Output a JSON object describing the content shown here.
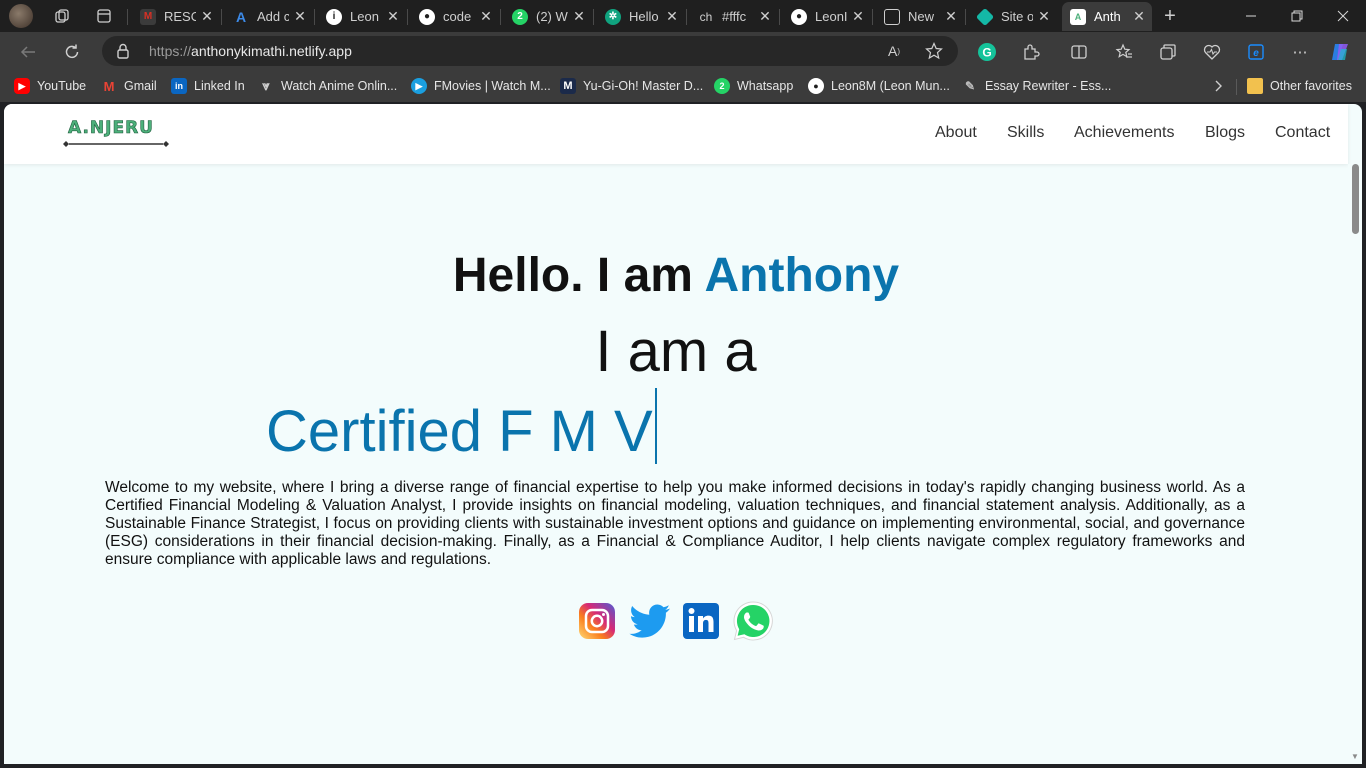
{
  "browser": {
    "tabs": [
      {
        "title": "RESO",
        "favicon": "gmail-icon",
        "color": "#d93025"
      },
      {
        "title": "Add c",
        "favicon": "azure-icon",
        "color": "#1f6fd0"
      },
      {
        "title": "Leon",
        "favicon": "info-icon",
        "color": "#ffffff"
      },
      {
        "title": "code",
        "favicon": "github-icon",
        "color": "#ffffff"
      },
      {
        "title": "(2) W",
        "favicon": "whatsapp-icon",
        "color": "#25d366"
      },
      {
        "title": "Hello",
        "favicon": "chatgpt-icon",
        "color": "#10a37f"
      },
      {
        "title": "#fffc",
        "favicon": "ch-text-icon",
        "color": "#1f1f1f"
      },
      {
        "title": "LeonI",
        "favicon": "github-icon",
        "color": "#ffffff"
      },
      {
        "title": "New",
        "favicon": "newtab-icon",
        "color": "#cfcfcf"
      },
      {
        "title": "Site o",
        "favicon": "netlify-icon",
        "color": "#14b8a6"
      },
      {
        "title": "Anth",
        "favicon": "site-icon",
        "color": "#ffffff",
        "active": true
      }
    ],
    "url": {
      "protocol": "https://",
      "host": "anthonykimathi.netlify.app"
    },
    "bookmarks": [
      {
        "label": "YouTube",
        "icon": "youtube-icon",
        "color": "#ff0000"
      },
      {
        "label": "Gmail",
        "icon": "gmail-icon",
        "color": "#ea4335"
      },
      {
        "label": "Linked In",
        "icon": "linkedin-icon",
        "color": "#0a66c2"
      },
      {
        "label": "Watch Anime Onlin...",
        "icon": "anime-icon",
        "color": "#cfcfcf"
      },
      {
        "label": "FMovies | Watch M...",
        "icon": "fmovies-icon",
        "color": "#1a9fe0"
      },
      {
        "label": "Yu-Gi-Oh! Master D...",
        "icon": "yugioh-icon",
        "color": "#1b2a4a"
      },
      {
        "label": "Whatsapp",
        "icon": "whatsapp-icon",
        "color": "#25d366"
      },
      {
        "label": "Leon8M (Leon Mun...",
        "icon": "github-icon",
        "color": "#ffffff"
      },
      {
        "label": "Essay Rewriter - Ess...",
        "icon": "essay-icon",
        "color": "#bbbbbb"
      }
    ],
    "other_favorites": "Other favorites"
  },
  "site": {
    "logo": "A.NJERU",
    "nav": [
      "About",
      "Skills",
      "Achievements",
      "Blogs",
      "Contact"
    ],
    "hero": {
      "greeting": "Hello. I am ",
      "name": "Anthony",
      "iam": "I am a",
      "typed": "Certified F M V"
    },
    "welcome": "Welcome to my website, where I bring a diverse range of financial expertise to help you make informed decisions in today's rapidly changing business world. As a Certified Financial Modeling & Valuation Analyst, I provide insights on financial modeling, valuation techniques, and financial statement analysis. Additionally, as a Sustainable Finance Strategist, I focus on providing clients with sustainable investment options and guidance on implementing environmental, social, and governance (ESG) considerations in their financial decision-making. Finally, as a Financial & Compliance Auditor, I help clients navigate complex regulatory frameworks and ensure compliance with applicable laws and regulations.",
    "socials": [
      "instagram-icon",
      "twitter-icon",
      "linkedin-icon",
      "whatsapp-icon"
    ],
    "colors": {
      "accent": "#0a74ad",
      "background": "#f3fcfc",
      "logo_green": "#4caf7a"
    }
  }
}
